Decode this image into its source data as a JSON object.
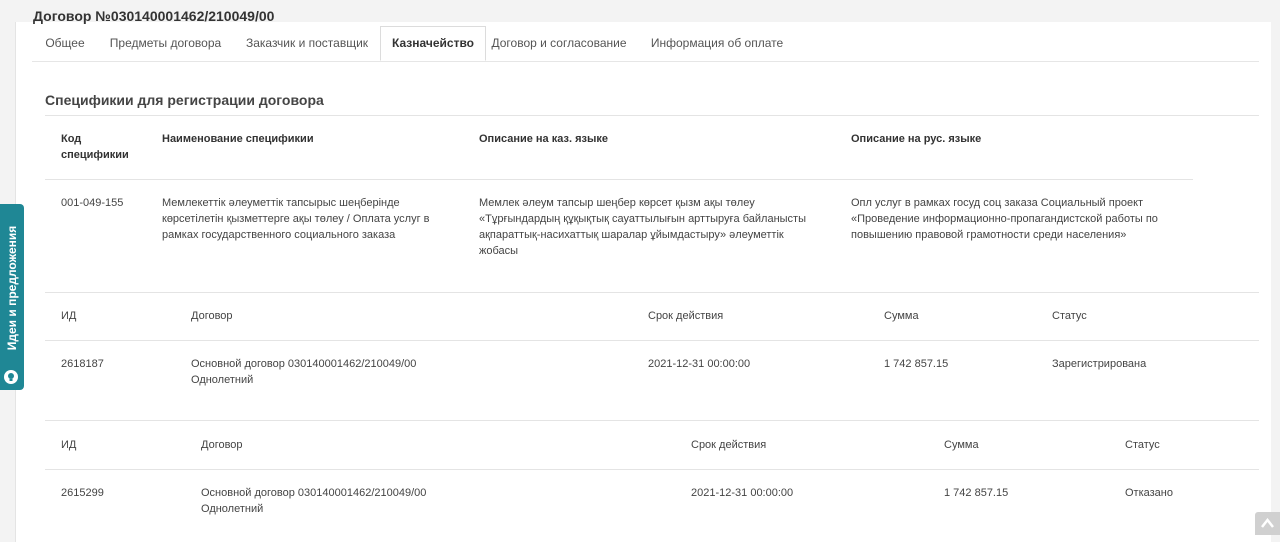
{
  "title": "Договор №030140001462/210049/00",
  "tabs": [
    {
      "label": "Общее"
    },
    {
      "label": "Предметы договора"
    },
    {
      "label": "Заказчик и поставщик"
    },
    {
      "label": "Казначейство"
    },
    {
      "label": "Договор и согласование"
    },
    {
      "label": "Информация об оплате"
    }
  ],
  "active_tab": "Казначейство",
  "spec_section": {
    "title": "Спецификии для регистрации договора",
    "headers": {
      "code_line1": "Код",
      "code_line2": "спецификии",
      "name": "Наименование спецификии",
      "desc_kz": "Описание на каз. языке",
      "desc_ru": "Описание на рус. языке"
    },
    "row": {
      "code": "001-049-155",
      "name_lines": [
        "Мемлекеттік әлеуметтік тапсырыс шеңберінде",
        "көрсетілетін қызметтерге ақы төлеу / Оплата услуг в",
        "рамках государственного социального заказа"
      ],
      "desc_kz_lines": [
        "Мемлек әлеум тапсыр шеңбер көрсет қызм ақы төлеу",
        "«Тұрғындардың құқықтық сауаттылығын арттыруға байланысты",
        "ақпараттық-насихаттық шаралар ұйымдастыру» әлеуметтік",
        "жобасы"
      ],
      "desc_ru_lines": [
        "Опл услуг в рамках госуд соц заказа Социальный проект",
        "«Проведение информационно-пропагандистской работы по",
        "повышению правовой грамотности среди населения»"
      ]
    }
  },
  "registrations": [
    {
      "headers": {
        "id": "ИД",
        "contract": "Договор",
        "term": "Срок действия",
        "sum": "Сумма",
        "status": "Статус"
      },
      "id": "2618187",
      "contract_line1": "Основной договор 030140001462/210049/00",
      "contract_line2": "Однолетний",
      "term": "2021-12-31 00:00:00",
      "sum": "1 742 857.15",
      "status": "Зарегистрирована"
    },
    {
      "headers": {
        "id": "ИД",
        "contract": "Договор",
        "term": "Срок действия",
        "sum": "Сумма",
        "status": "Статус"
      },
      "id": "2615299",
      "contract_line1": "Основной договор 030140001462/210049/00",
      "contract_line2": "Однолетний",
      "term": "2021-12-31 00:00:00",
      "sum": "1 742 857.15",
      "status": "Отказано"
    }
  ],
  "feedback_tab": {
    "label": "Идеи и предложения",
    "icon": "lightbulb-icon"
  },
  "scroll_top": {
    "icon": "chevron-up-icon"
  }
}
